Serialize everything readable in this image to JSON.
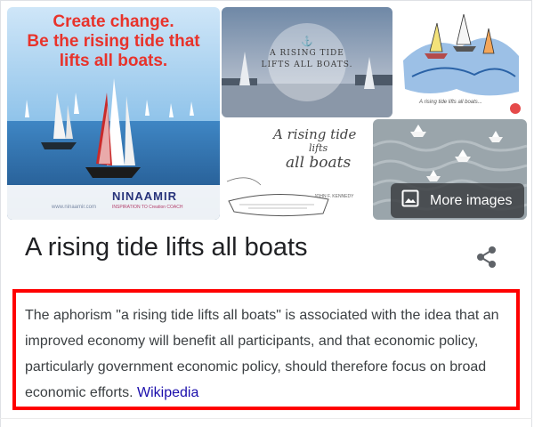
{
  "images": {
    "img1": {
      "headline_line1": "Create change.",
      "headline_line2": "Be the rising tide that",
      "headline_line3": "lifts all boats.",
      "brand": "NINAAMIR",
      "website": "www.ninaamir.com",
      "brand_subtitle": "INSPIRATION TO Creation COACH"
    },
    "img2": {
      "line1": "A RISING TIDE",
      "line2": "LIFTS ALL BOATS."
    },
    "img3": {
      "caption": "A rising tide lifts all boats..."
    },
    "img4": {
      "script_line1": "A rising tide",
      "script_line2": "lifts",
      "script_line3": "all boats",
      "attribution": "JOHN F. KENNEDY"
    },
    "more_images_label": "More images"
  },
  "title": "A rising tide lifts all boats",
  "description": {
    "text": "The aphorism \"a rising tide lifts all boats\" is associated with the idea that an improved economy will benefit all participants, and that economic policy, particularly government economic policy, should therefore focus on broad economic efforts.",
    "source_link": "Wikipedia"
  },
  "icons": {
    "share": "share-icon",
    "more_images": "image-gallery-icon"
  },
  "colors": {
    "highlight_border": "#ff0000",
    "link": "#1a0dab",
    "headline_red": "#e8332b",
    "brand_blue": "#27337a"
  }
}
